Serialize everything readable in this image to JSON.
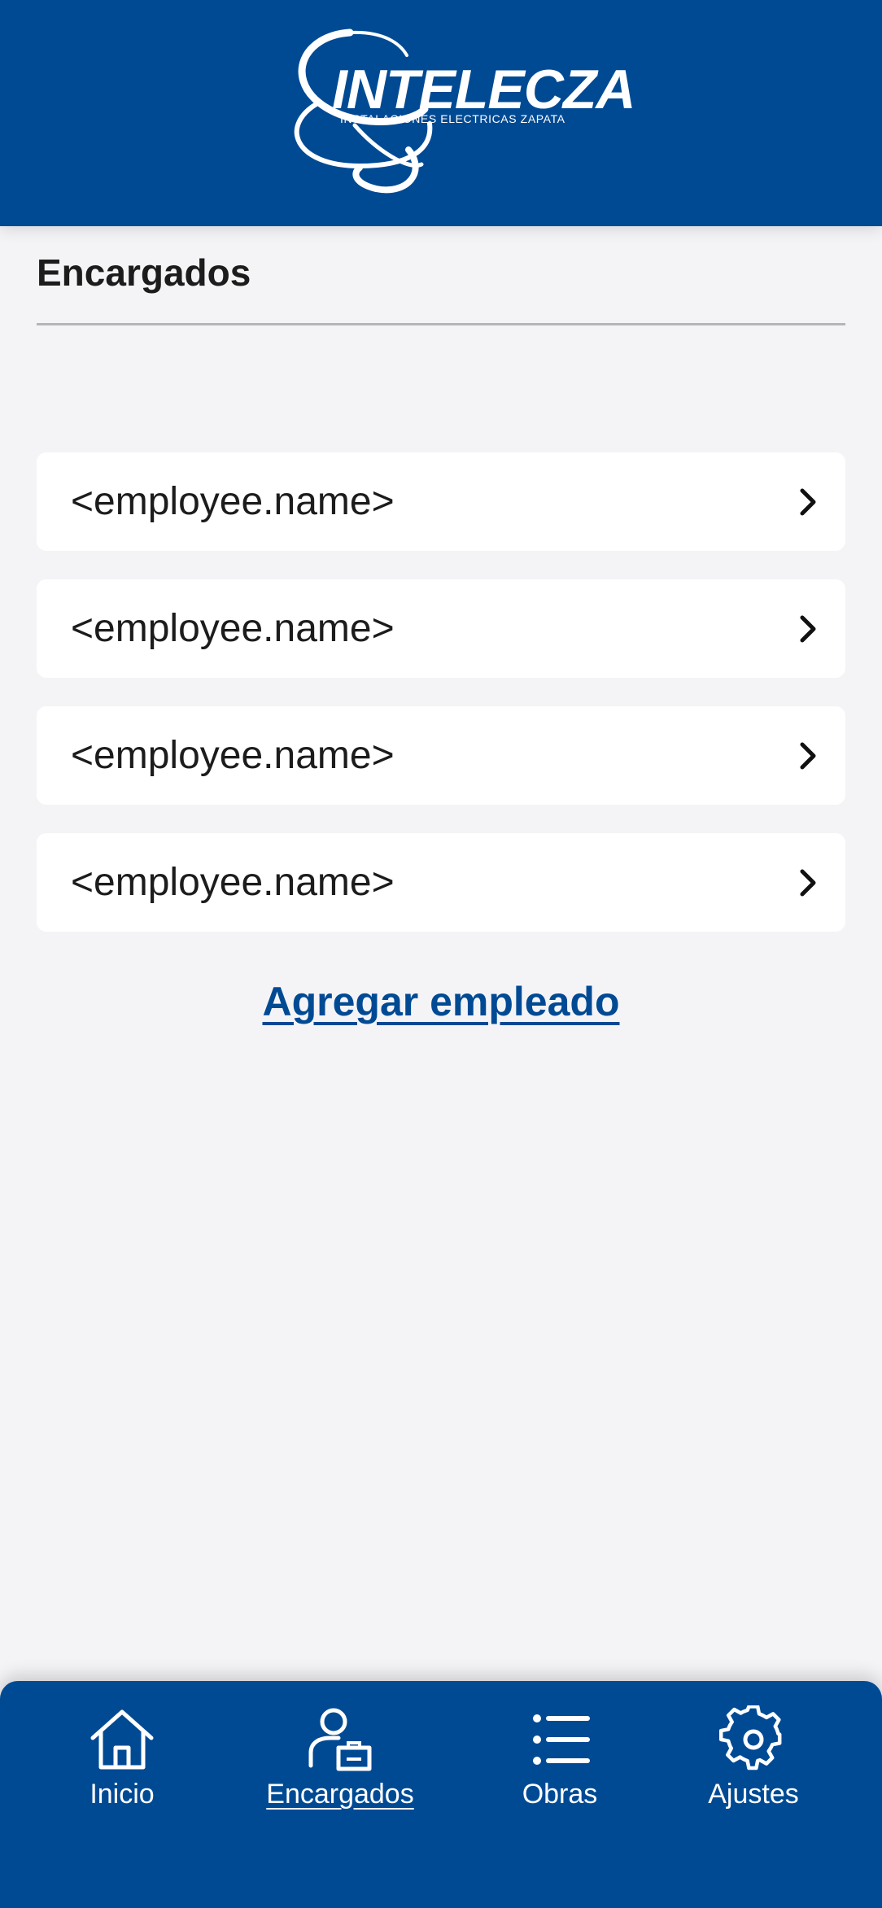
{
  "header": {
    "logo": {
      "name": "INTELECZA",
      "tagline": "INSTALACIONES ELECTRICAS ZAPATA"
    }
  },
  "section": {
    "title": "Encargados"
  },
  "employees": [
    {
      "name": "<employee.name>"
    },
    {
      "name": "<employee.name>"
    },
    {
      "name": "<employee.name>"
    },
    {
      "name": "<employee.name>"
    }
  ],
  "actions": {
    "add_employee_label": "Agregar empleado"
  },
  "bottom_nav": {
    "items": [
      {
        "label": "Inicio",
        "icon": "home-icon",
        "active": false
      },
      {
        "label": "Encargados",
        "icon": "person-briefcase-icon",
        "active": true
      },
      {
        "label": "Obras",
        "icon": "list-icon",
        "active": false
      },
      {
        "label": "Ajustes",
        "icon": "gear-icon",
        "active": false
      }
    ]
  },
  "colors": {
    "brand_blue": "#004a94",
    "background": "#f4f4f7",
    "card": "#ffffff",
    "text": "#1c1c1c"
  }
}
